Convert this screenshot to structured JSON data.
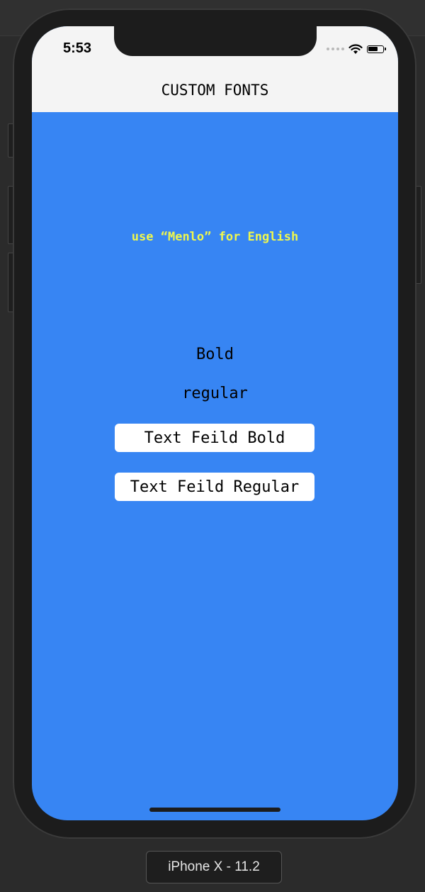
{
  "status_bar": {
    "time": "5:53"
  },
  "nav": {
    "title": "CUSTOM FONTS"
  },
  "content": {
    "font_note": "use “Menlo” for English",
    "bold_label": "Bold",
    "regular_label": "regular",
    "text_field_bold": "Text Feild Bold",
    "text_field_regular": "Text Feild Regular"
  },
  "simulator": {
    "device_label": "iPhone X - 11.2"
  },
  "colors": {
    "background": "#3785f3",
    "nav_bar": "#f4f4f4",
    "note_text": "#f0f84c",
    "field_background": "#ffffff"
  },
  "icons": [
    "signal-dots-icon",
    "wifi-icon",
    "battery-icon"
  ]
}
